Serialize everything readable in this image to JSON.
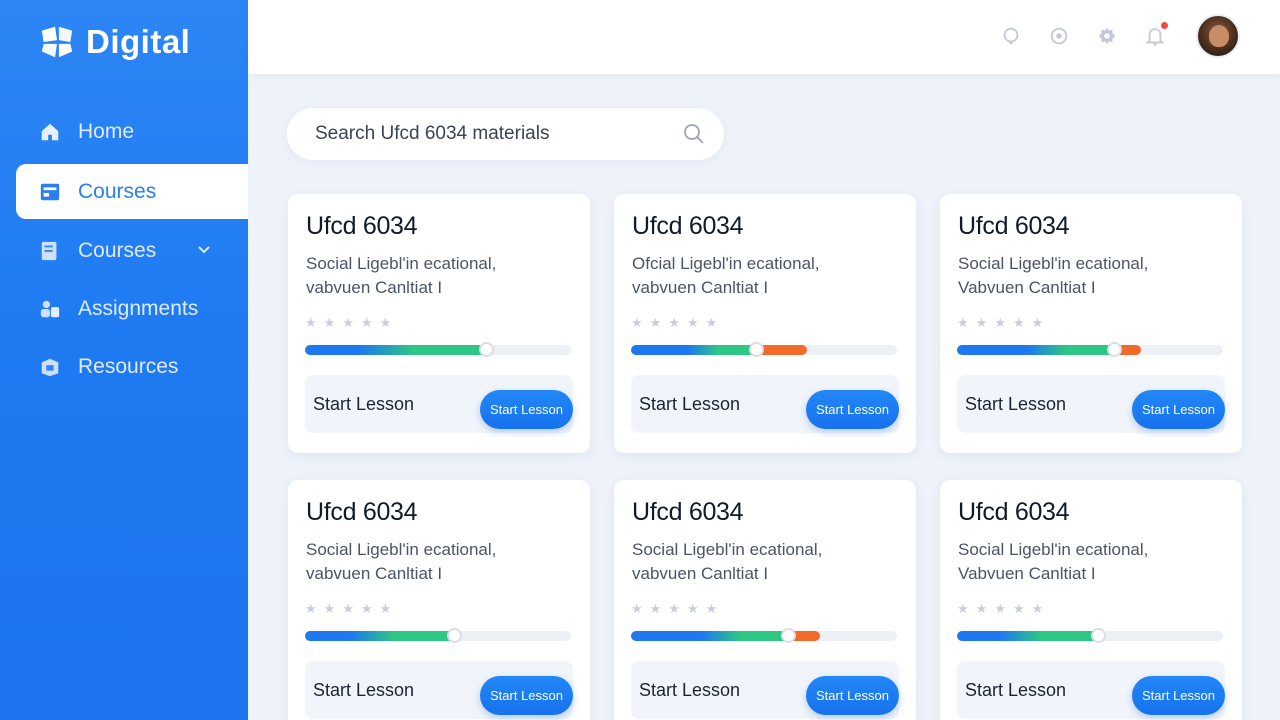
{
  "app": {
    "brand_name": "Digital",
    "brand_logo_icon": "tiles-logo-icon"
  },
  "sidebar": {
    "items": [
      {
        "label": "Home",
        "icon": "home-icon",
        "active": false
      },
      {
        "label": "Courses",
        "icon": "courses-icon",
        "active": true
      },
      {
        "label": "Courses",
        "icon": "book-icon",
        "active": false,
        "has_dropdown": true
      },
      {
        "label": "Assignments",
        "icon": "assignments-icon",
        "active": false
      },
      {
        "label": "Resources",
        "icon": "resources-icon",
        "active": false
      }
    ]
  },
  "topbar": {
    "icons": [
      "help-icon",
      "chat-icon",
      "settings-icon",
      "bell-icon"
    ],
    "notification_dot": true,
    "avatar": "user-avatar"
  },
  "search": {
    "placeholder": "Search Ufcd 6034 materials",
    "value": ""
  },
  "colors": {
    "sidebar_blue": "#1f7bf2",
    "accent_blue": "#1672ed",
    "progress_blue": "#1e78f0",
    "progress_green": "#2ec783",
    "progress_orange": "#f26a2a",
    "notification_red": "#f24a3c"
  },
  "cards": [
    {
      "title": "Ufcd 6034",
      "desc_line1": "Social Ligebl'in ecational,",
      "desc_line2": "vabvuen Canltiat I",
      "rating": 0,
      "progress": 0.68,
      "orange_segment": 0,
      "footer_label": "Start Lesson",
      "button_label": "Start Lesson"
    },
    {
      "title": "Ufcd 6034",
      "desc_line1": "Ofcial Ligebl'in ecational,",
      "desc_line2": "vabvuen Canltiat I",
      "rating": 0,
      "progress": 0.47,
      "orange_segment": 0.66,
      "footer_label": "Start Lesson",
      "button_label": "Start Lesson"
    },
    {
      "title": "Ufcd 6034",
      "desc_line1": "Social Ligebl'in ecational,",
      "desc_line2": "Vabvuen Canltiat I",
      "rating": 0,
      "progress": 0.59,
      "orange_segment": 0.69,
      "footer_label": "Start Lesson",
      "button_label": "Start Lesson"
    },
    {
      "title": "Ufcd 6034",
      "desc_line1": "Social Ligebl'in ecational,",
      "desc_line2": "vabvuen Canltiat I",
      "rating": 0,
      "progress": 0.56,
      "orange_segment": 0,
      "footer_label": "Start Lesson",
      "button_label": "Start Lesson"
    },
    {
      "title": "Ufcd 6034",
      "desc_line1": "Social Ligebl'in ecational,",
      "desc_line2": "vabvuen Canltiat I",
      "rating": 0,
      "progress": 0.59,
      "orange_segment": 0.71,
      "footer_label": "Start Lesson",
      "button_label": "Start Lesson"
    },
    {
      "title": "Ufcd 6034",
      "desc_line1": "Social Ligebl'in ecational,",
      "desc_line2": "Vabvuen Canltiat I",
      "rating": 0,
      "progress": 0.53,
      "orange_segment": 0,
      "footer_label": "Start Lesson",
      "button_label": "Start Lesson"
    }
  ]
}
